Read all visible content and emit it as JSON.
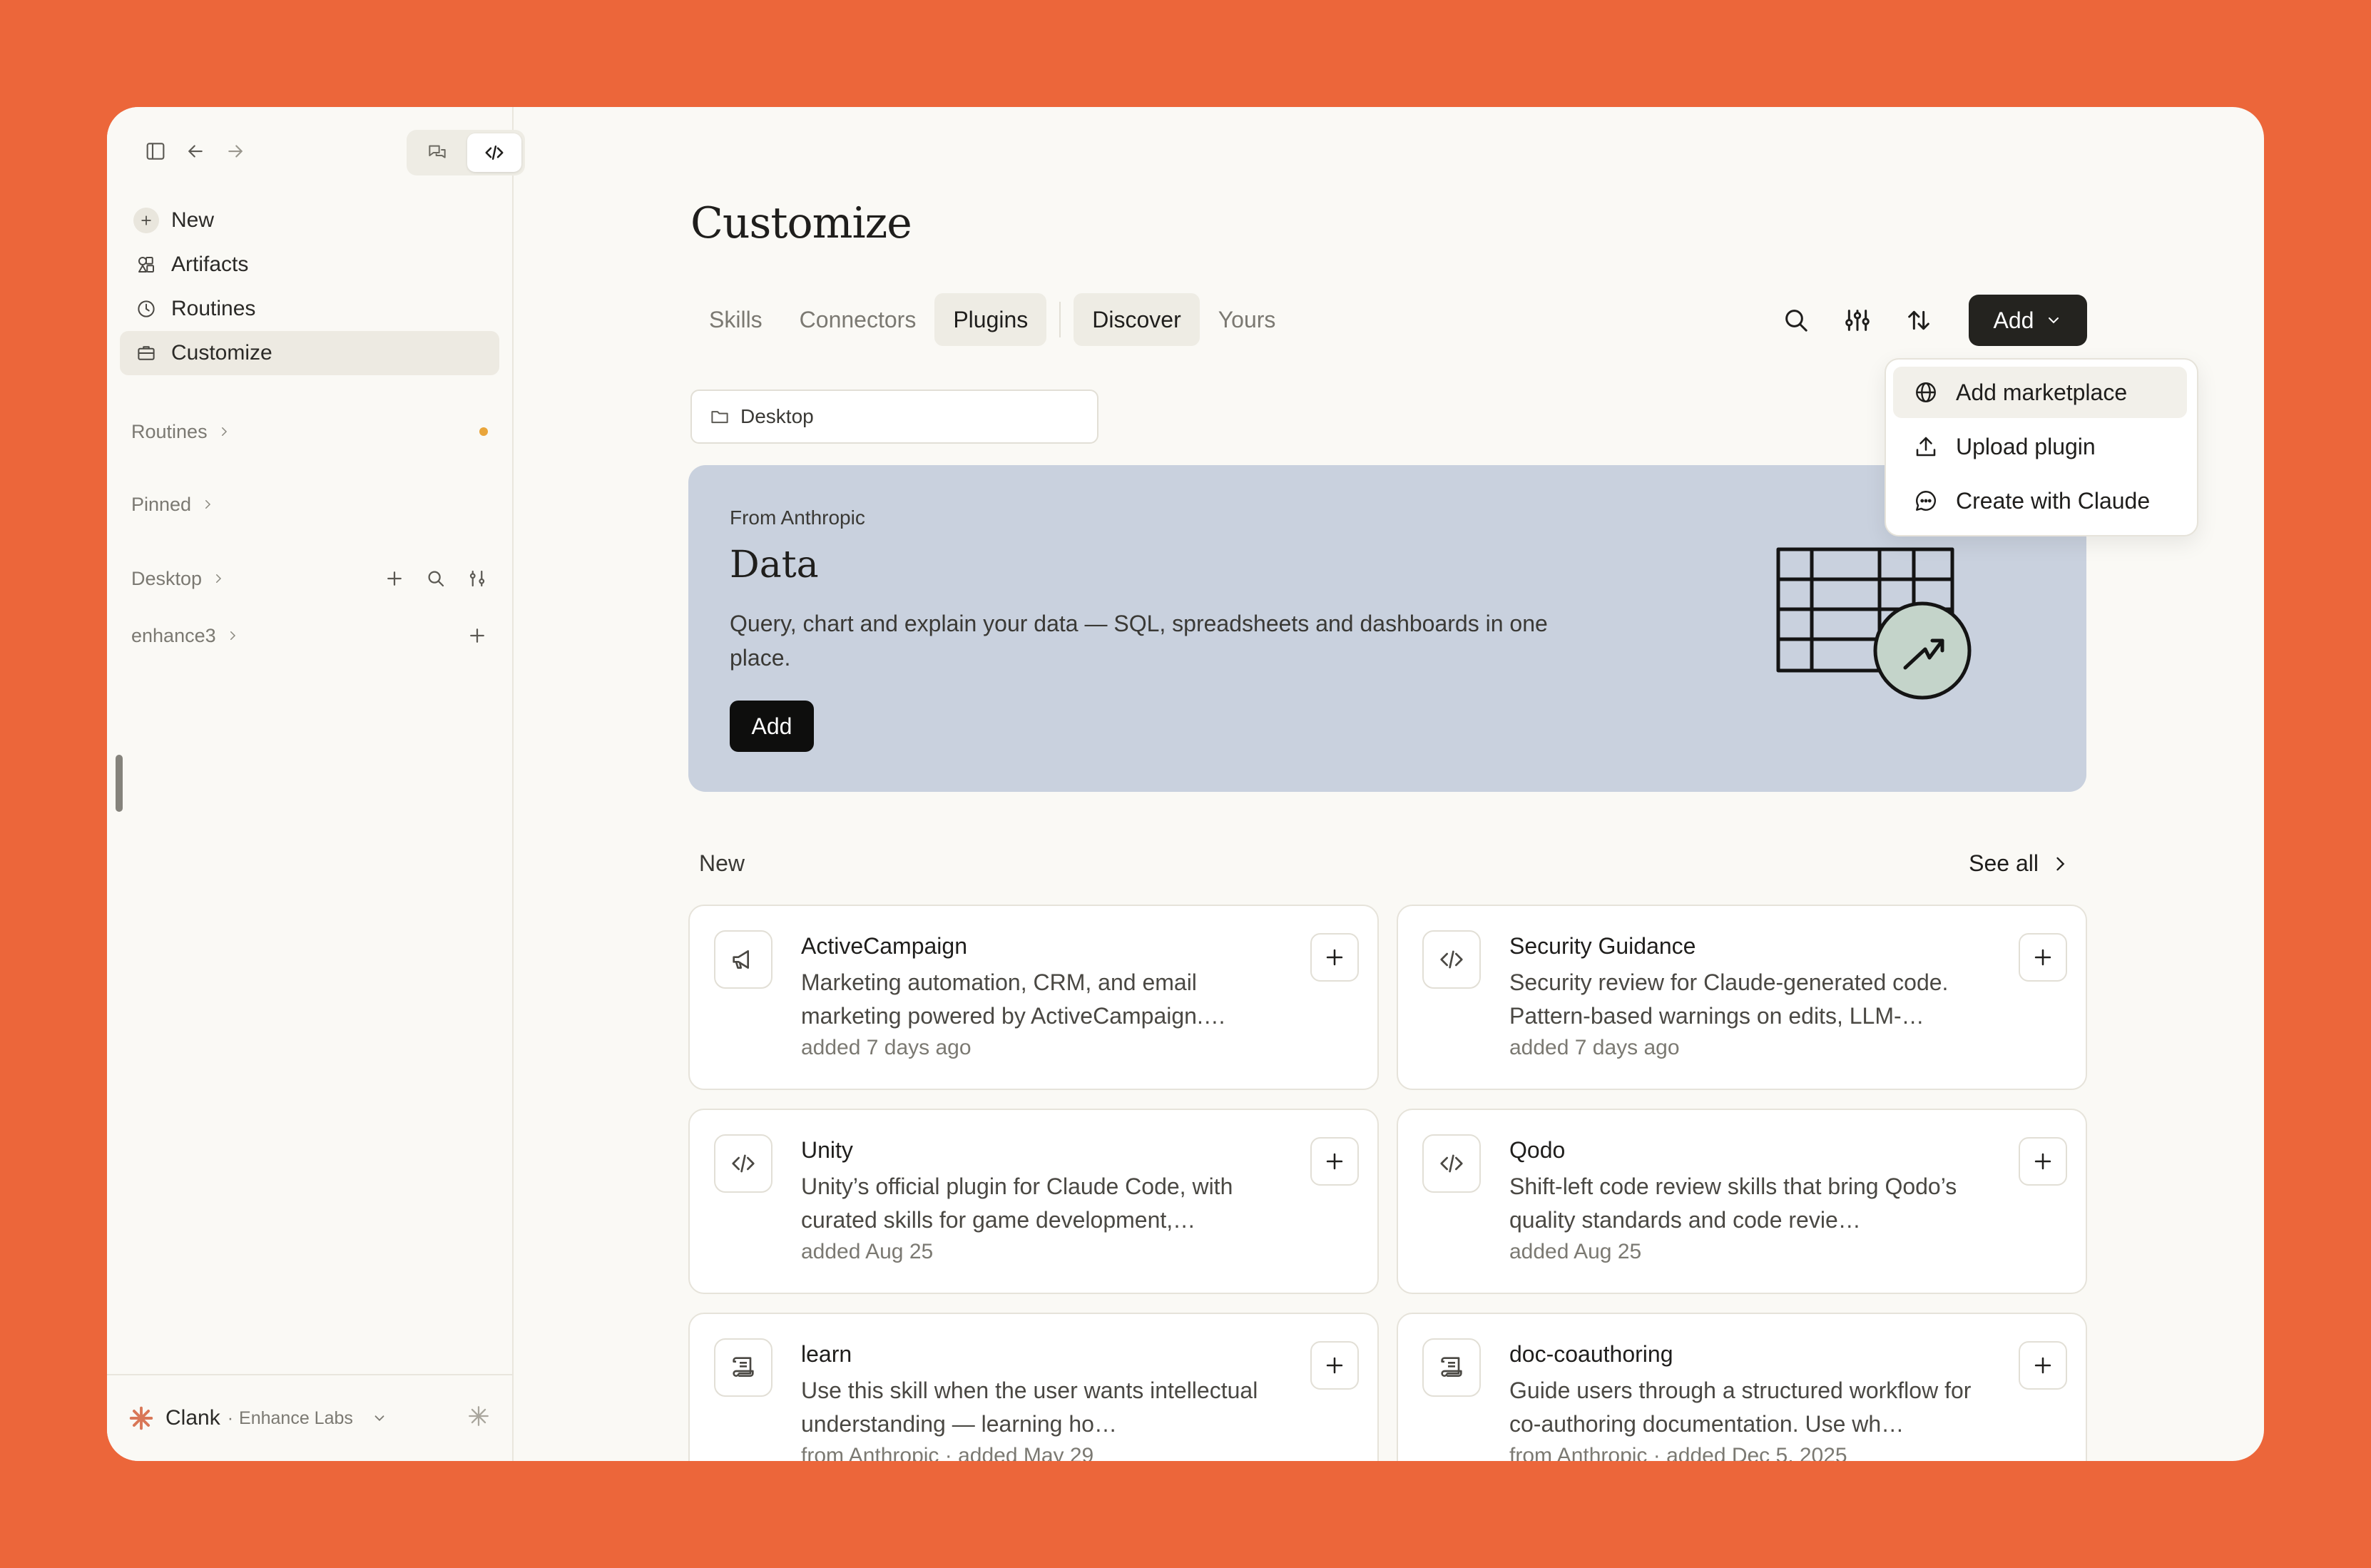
{
  "sidebar": {
    "nav": [
      {
        "label": "New",
        "icon": "plus-icon"
      },
      {
        "label": "Artifacts",
        "icon": "artifacts-icon"
      },
      {
        "label": "Routines",
        "icon": "clock-icon"
      },
      {
        "label": "Customize",
        "icon": "briefcase-icon",
        "active": true
      }
    ],
    "sections": {
      "routines": "Routines",
      "pinned": "Pinned",
      "desktop": "Desktop",
      "enhance3": "enhance3"
    },
    "user": {
      "name": "Clank",
      "separator": "·",
      "org": "Enhance Labs"
    }
  },
  "main": {
    "title": "Customize",
    "tabs": [
      "Skills",
      "Connectors",
      "Plugins"
    ],
    "subtabs": [
      "Discover",
      "Yours"
    ],
    "active_tab": "Plugins",
    "active_subtab": "Discover",
    "add_label": "Add",
    "environment": "Desktop",
    "dropdown": [
      {
        "label": "Add marketplace",
        "icon": "globe-icon"
      },
      {
        "label": "Upload plugin",
        "icon": "upload-icon"
      },
      {
        "label": "Create with Claude",
        "icon": "chat-bubble-icon"
      }
    ],
    "hero": {
      "eyebrow": "From Anthropic",
      "title": "Data",
      "description": "Query, chart and explain your data — SQL, spreadsheets and dashboards in one place.",
      "button": "Add"
    },
    "new_section": {
      "label": "New",
      "see_all": "See all"
    },
    "cards": [
      {
        "name": "ActiveCampaign",
        "desc": "Marketing automation, CRM, and email marketing powered by ActiveCampaign.…",
        "meta": "added 7 days ago",
        "icon": "megaphone-icon"
      },
      {
        "name": "Security Guidance",
        "desc": "Security review for Claude-generated code. Pattern-based warnings on edits, LLM-…",
        "meta": "added 7 days ago",
        "icon": "code-icon"
      },
      {
        "name": "Unity",
        "desc": "Unity’s official plugin for Claude Code, with curated skills for game development,…",
        "meta": "added Aug 25",
        "icon": "code-icon"
      },
      {
        "name": "Qodo",
        "desc": "Shift-left code review skills that bring Qodo’s quality standards and code revie…",
        "meta": "added Aug 25",
        "icon": "code-icon"
      },
      {
        "name": "learn",
        "desc": "Use this skill when the user wants intellectual understanding — learning ho…",
        "meta": "from Anthropic  ·  added May 29",
        "icon": "scroll-icon"
      },
      {
        "name": "doc-coauthoring",
        "desc": "Guide users through a structured workflow for co-authoring documentation. Use wh…",
        "meta": "from Anthropic  ·  added Dec 5, 2025",
        "icon": "scroll-icon"
      }
    ]
  },
  "colors": {
    "background": "#EC663A",
    "window": "#FAF9F5",
    "hero": "#C9D1DE",
    "accent_dot": "#E9A53A"
  }
}
